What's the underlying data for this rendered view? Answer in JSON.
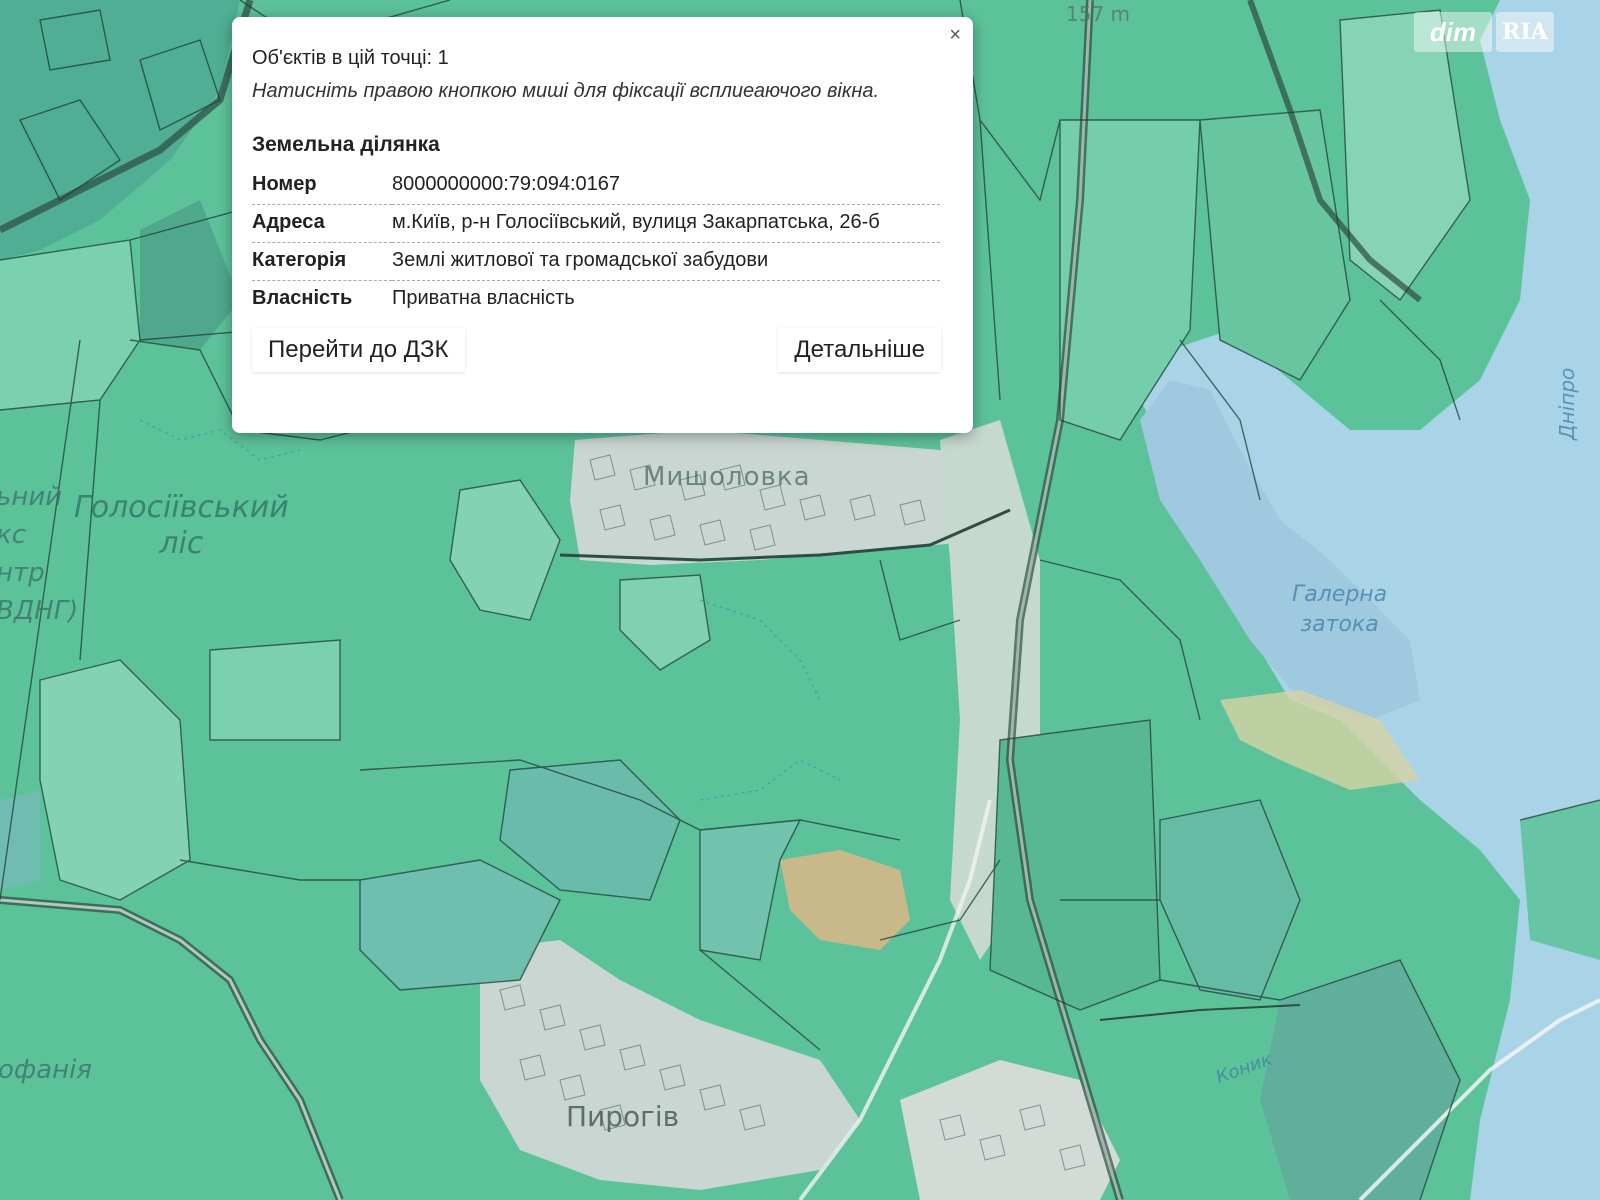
{
  "map": {
    "labels": {
      "holosiiv_line1": "Голосіївський",
      "holosiiv_line2": "ліс",
      "expo_line1": "ьний",
      "expo_line2": "кс",
      "expo_line3": "нтр",
      "expo_line4": "ВДНГ)",
      "feofaniia": "офанія",
      "halerna_line1": "Галерна",
      "halerna_line2": "затока",
      "dnipro": "Дніпро",
      "koniok": "Коник",
      "myshelovka": "Мишоловка",
      "pyrohiv": "Пирогів",
      "peak": "157 m"
    },
    "brands": {
      "dim": "dim",
      "ria": "RIA"
    },
    "colors": {
      "forest": "#5cc29a",
      "parcel": "#7bd0b0",
      "water": "#a9d3e6",
      "urban": "#c9d6d1",
      "sand": "#c9b98a",
      "line": "#1f3e36"
    }
  },
  "popup": {
    "close_symbol": "×",
    "count_text": "Об'єктів в цій точці: 1",
    "hint_text": "Натисніть правою кнопкою миші для фіксації всплиеаючого вікна.",
    "section_title": "Земельна ділянка",
    "rows": [
      {
        "key": "Номер",
        "value": "8000000000:79:094:0167"
      },
      {
        "key": "Адреса",
        "value": "м.Київ, р-н Голосіївський, вулиця Закарпатська, 26-б"
      },
      {
        "key": "Категорія",
        "value": "Землі житлової та громадської забудови"
      },
      {
        "key": "Власність",
        "value": "Приватна власність"
      }
    ],
    "button_dzk": "Перейти до ДЗК",
    "button_more": "Детальніше"
  }
}
